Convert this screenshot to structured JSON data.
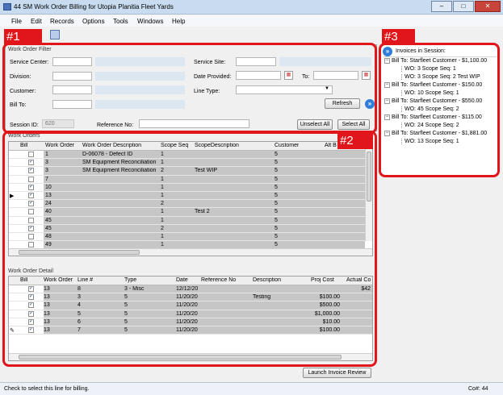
{
  "window": {
    "title": "44 SM Work Order Billing for Utopia Planitia Fleet Yards",
    "minimize": "–",
    "maximize": "□",
    "close": "✕"
  },
  "menu": [
    "File",
    "Edit",
    "Records",
    "Options",
    "Tools",
    "Windows",
    "Help"
  ],
  "annotations": {
    "a1": "#1",
    "a2": "#2",
    "a3": "#3"
  },
  "filter": {
    "title": "Work Order Filter",
    "service_center": "Service Center:",
    "division": "Division:",
    "customer": "Customer:",
    "bill_to": "Bill To:",
    "service_site": "Service Site:",
    "date_provided": "Date Provided:",
    "to": "To:",
    "line_type": "Line Type:",
    "refresh": "Refresh",
    "session_id_label": "Session ID:",
    "session_id": "620",
    "reference_no": "Reference No:",
    "unselect_all": "Unselect All",
    "select_all": "Select All"
  },
  "work_orders": {
    "title": "Work Orders",
    "headers": [
      "Bill",
      "Work Order",
      "Work Order Description",
      "Scope Seq",
      "ScopeDescription",
      "Customer",
      "Alt B"
    ],
    "rows": [
      {
        "checked": false,
        "wo": "1",
        "desc": "D-06078 - Defect ID",
        "seq": "1",
        "sdesc": "",
        "cust": "5"
      },
      {
        "checked": true,
        "wo": "3",
        "desc": "SM Equipment Reconciliation",
        "seq": "1",
        "sdesc": "",
        "cust": "5"
      },
      {
        "checked": true,
        "wo": "3",
        "desc": "SM Equipment Reconciliation",
        "seq": "2",
        "sdesc": "Test WIP",
        "cust": "5"
      },
      {
        "checked": false,
        "wo": "7",
        "desc": "",
        "seq": "1",
        "sdesc": "",
        "cust": "5"
      },
      {
        "checked": true,
        "wo": "10",
        "desc": "",
        "seq": "1",
        "sdesc": "",
        "cust": "5"
      },
      {
        "checked": true,
        "wo": "13",
        "desc": "",
        "seq": "1",
        "sdesc": "",
        "cust": "5",
        "current": true
      },
      {
        "checked": true,
        "wo": "24",
        "desc": "",
        "seq": "2",
        "sdesc": "",
        "cust": "5"
      },
      {
        "checked": false,
        "wo": "40",
        "desc": "",
        "seq": "1",
        "sdesc": "Test 2",
        "cust": "5"
      },
      {
        "checked": false,
        "wo": "45",
        "desc": "",
        "seq": "1",
        "sdesc": "",
        "cust": "5"
      },
      {
        "checked": true,
        "wo": "45",
        "desc": "",
        "seq": "2",
        "sdesc": "",
        "cust": "5"
      },
      {
        "checked": false,
        "wo": "48",
        "desc": "",
        "seq": "1",
        "sdesc": "",
        "cust": "5"
      },
      {
        "checked": false,
        "wo": "49",
        "desc": "",
        "seq": "1",
        "sdesc": "",
        "cust": "5"
      }
    ]
  },
  "detail": {
    "title": "Work Order Detail",
    "headers": [
      "Bill",
      "Work Order",
      "Line #",
      "Type",
      "Date",
      "Reference No",
      "Description",
      "Proj Cost",
      "Actual Co"
    ],
    "rows": [
      {
        "checked": true,
        "wo": "13",
        "line": "8",
        "type": "3 - Misc",
        "date": "12/12/20",
        "ref": "",
        "desc": "",
        "proj": "",
        "actual": "$42"
      },
      {
        "checked": true,
        "wo": "13",
        "line": "3",
        "type": "5",
        "date": "11/20/20",
        "ref": "",
        "desc": "Testing",
        "proj": "$100.00",
        "actual": ""
      },
      {
        "checked": true,
        "wo": "13",
        "line": "4",
        "type": "5",
        "date": "11/20/20",
        "ref": "",
        "desc": "",
        "proj": "$500.00",
        "actual": ""
      },
      {
        "checked": true,
        "wo": "13",
        "line": "5",
        "type": "5",
        "date": "11/20/20",
        "ref": "",
        "desc": "",
        "proj": "$1,000.00",
        "actual": ""
      },
      {
        "checked": true,
        "wo": "13",
        "line": "6",
        "type": "5",
        "date": "11/20/20",
        "ref": "",
        "desc": "",
        "proj": "$10.00",
        "actual": ""
      },
      {
        "checked": true,
        "wo": "13",
        "line": "7",
        "type": "5",
        "date": "11/20/20",
        "ref": "",
        "desc": "",
        "proj": "$100.00",
        "actual": ""
      }
    ]
  },
  "launch": "Launch Invoice Review",
  "invoices": {
    "title": "Invoices in Session:",
    "tree": [
      {
        "bill": "Bill To: Starfleet Customer - $1,100.00",
        "items": [
          "WO: 3 Scope Seq: 1",
          "WO: 3 Scope Seq: 2 Test WIP"
        ]
      },
      {
        "bill": "Bill To: Starfleet Customer - $150.00",
        "items": [
          "WO: 10 Scope Seq: 1"
        ]
      },
      {
        "bill": "Bill To: Starfleet Customer - $550.00",
        "items": [
          "WO: 45 Scope Seq: 2"
        ]
      },
      {
        "bill": "Bill To: Starfleet Customer - $115.00",
        "items": [
          "WO: 24 Scope Seq: 2"
        ]
      },
      {
        "bill": "Bill To: Starfleet Customer - $1,881.00",
        "items": [
          "WO: 13 Scope Seq: 1"
        ]
      }
    ]
  },
  "status": {
    "message": "Check to select this line for billing.",
    "company": "Co#: 44"
  }
}
